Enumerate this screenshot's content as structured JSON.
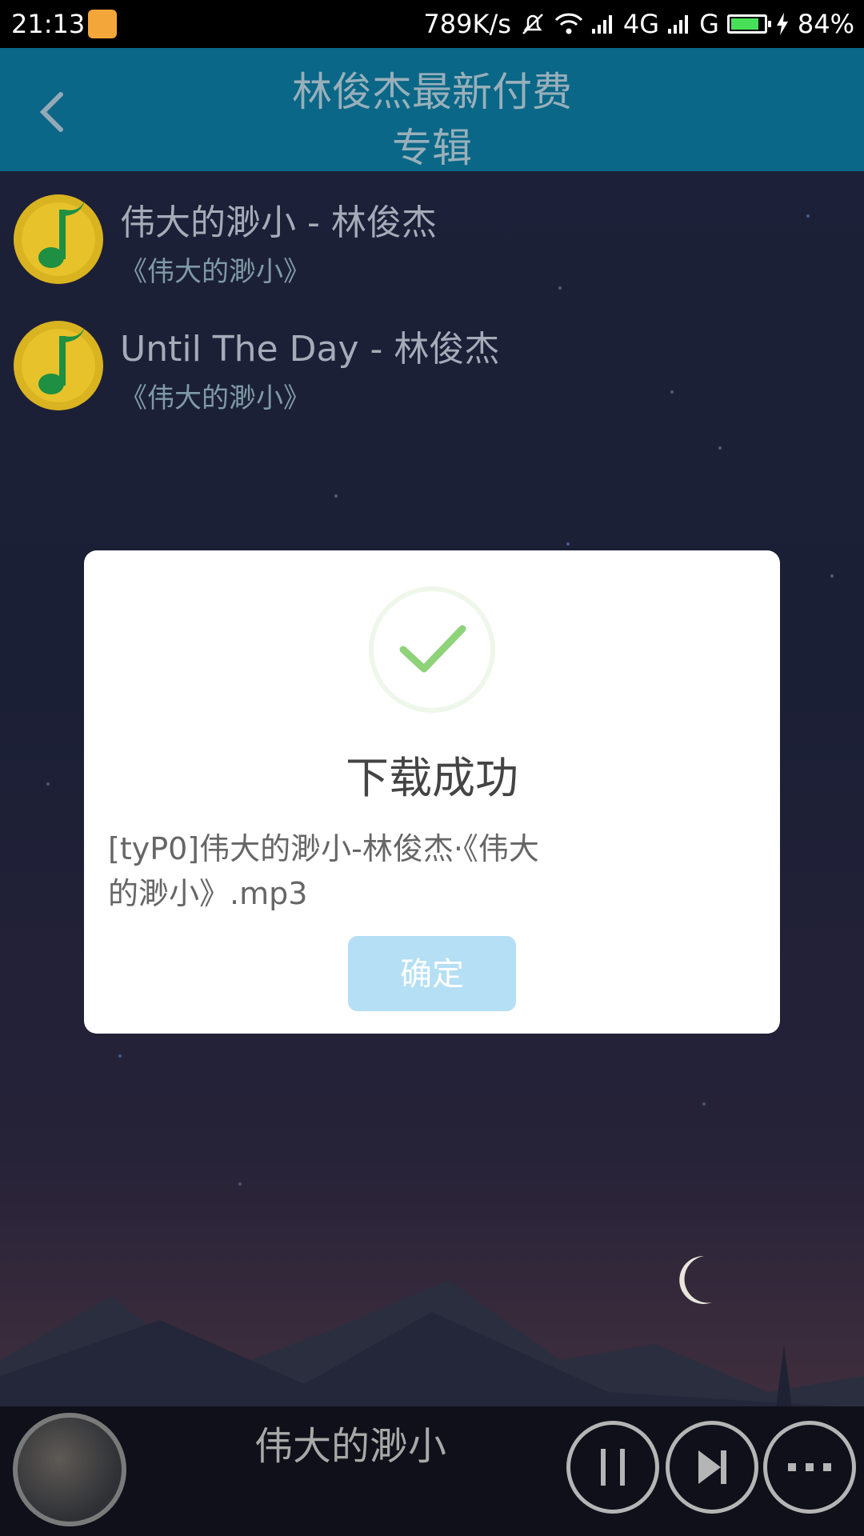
{
  "status_bar": {
    "time": "21:13",
    "net_speed": "789K/s",
    "network1": "4G",
    "network2": "G",
    "battery": "84%",
    "icons": [
      "app-icon",
      "mute-bell-icon",
      "wifi-icon",
      "signal-icon",
      "battery-icon",
      "charging-icon"
    ]
  },
  "header": {
    "title_line1": "林俊杰最新付费",
    "title_line2": "专辑",
    "color": "#0a6b8c"
  },
  "songs": [
    {
      "title": "伟大的渺小 - 林俊杰",
      "album": "《伟大的渺小》"
    },
    {
      "title": "Until The Day - 林俊杰",
      "album": "《伟大的渺小》"
    }
  ],
  "dialog": {
    "title": "下载成功",
    "message": "[tyP0]伟大的渺小-林俊杰·《伟大的渺小》.mp3",
    "confirm_label": "确定",
    "confirm_color": "#b4dff4",
    "check_color": "#8ed27a"
  },
  "player": {
    "now_playing": "伟大的渺小",
    "buttons": [
      "pause-icon",
      "next-icon",
      "more-icon"
    ]
  }
}
